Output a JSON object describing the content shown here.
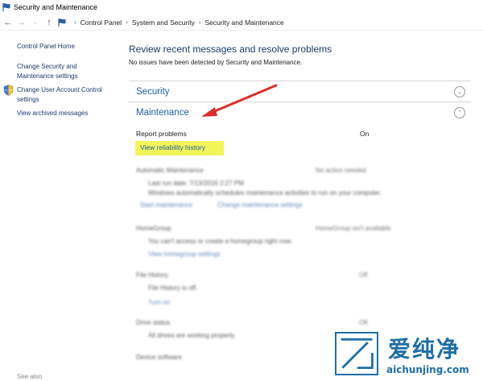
{
  "window": {
    "title": "Security and Maintenance"
  },
  "address_bar": {
    "crumbs": [
      "Control Panel",
      "Security and Maintenance"
    ],
    "crumb_middle": "System and Security"
  },
  "sidebar": {
    "items": [
      {
        "label": "Control Panel Home"
      },
      {
        "label": "Change Security and"
      },
      {
        "label": "Maintenance settings"
      },
      {
        "label": "Change User Account Control"
      },
      {
        "label": "settings"
      },
      {
        "label": "View archived messages"
      }
    ],
    "see_also": "See also"
  },
  "main": {
    "heading": "Review recent messages and resolve problems",
    "subtext": "No issues have been detected by Security and Maintenance.",
    "sections": [
      {
        "label": "Security",
        "state": "collapsed"
      },
      {
        "label": "Maintenance",
        "state": "expanded"
      }
    ],
    "report_problems": {
      "label": "Report problems",
      "status": "On"
    },
    "reliability_link": "View reliability history",
    "blurred": {
      "auto_maint": "Automatic Maintenance",
      "auto_maint_status": "No action needed",
      "last_run": "Last run date: 7/13/2016 2:27 PM",
      "auto_desc": "Windows automatically schedules maintenance activities to run on your computer.",
      "start_link": "Start maintenance",
      "change_link": "Change maintenance settings",
      "homegroup": "HomeGroup",
      "homegroup_status": "HomeGroup isn't available",
      "homegroup_desc": "You can't access or create a homegroup right now.",
      "homegroup_link": "View homegroup settings",
      "file_history": "File History",
      "file_history_status": "Off",
      "file_history_desc": "File History is off.",
      "turn_on": "Turn on",
      "drive_status": "Drive status",
      "drive_status_value": "OK",
      "drive_desc": "All drives are working properly.",
      "device_software": "Device software"
    }
  },
  "watermark": {
    "chinese": "爱纯净",
    "url": "aichunjing.com"
  },
  "colors": {
    "link": "#1f5fa0",
    "highlight": "#f2f55a",
    "arrow": "#d9302c",
    "watermark": "#1e6ea6"
  }
}
